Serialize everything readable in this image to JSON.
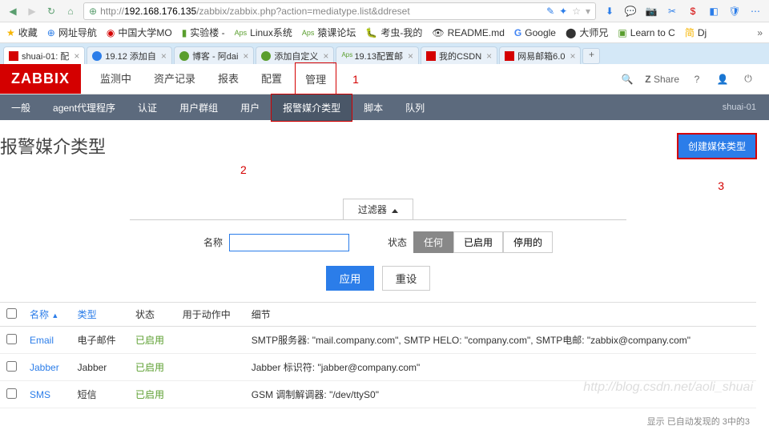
{
  "browser": {
    "url_prefix": "http://",
    "url_host": "192.168.176.135",
    "url_path": "/zabbix/zabbix.php?action=mediatype.list&ddreset"
  },
  "bookmarks": [
    "收藏",
    "网址导航",
    "中国大学MO",
    "实验楼 -",
    "Linux系统",
    "猿课论坛",
    "考虫-我的",
    "README.md",
    "Google",
    "大师兄",
    "Learn to C",
    "Dj"
  ],
  "tabs": [
    {
      "label": "shuai-01: 配",
      "active": true
    },
    {
      "label": "19.12 添加自",
      "active": false
    },
    {
      "label": "博客 - 阿dai",
      "active": false
    },
    {
      "label": "添加自定义",
      "active": false
    },
    {
      "label": "19.13配置邮",
      "active": false
    },
    {
      "label": "我的CSDN",
      "active": false
    },
    {
      "label": "网易邮箱6.0",
      "active": false
    }
  ],
  "zabbix_logo": "ZABBIX",
  "main_nav": [
    "监测中",
    "资产记录",
    "报表",
    "配置",
    "管理"
  ],
  "main_nav_active": 4,
  "annotations": {
    "a1": "1",
    "a2": "2",
    "a3": "3"
  },
  "header_share": "Share",
  "sub_nav": [
    "一般",
    "agent代理程序",
    "认证",
    "用户群组",
    "用户",
    "报警媒介类型",
    "脚本",
    "队列"
  ],
  "sub_nav_active": 5,
  "sub_nav_user": "shuai-01",
  "page_title": "报警媒介类型",
  "create_button": "创建媒体类型",
  "filter": {
    "tab": "过滤器",
    "name_label": "名称",
    "status_label": "状态",
    "status_options": [
      "任何",
      "已启用",
      "停用的"
    ],
    "status_active": 0,
    "apply": "应用",
    "reset": "重设"
  },
  "table": {
    "headers": {
      "name": "名称",
      "type": "类型",
      "status": "状态",
      "used_in": "用于动作中",
      "details": "细节"
    },
    "rows": [
      {
        "name": "Email",
        "type": "电子邮件",
        "status": "已启用",
        "details": "SMTP服务器: \"mail.company.com\", SMTP HELO: \"company.com\", SMTP电邮: \"zabbix@company.com\""
      },
      {
        "name": "Jabber",
        "type": "Jabber",
        "status": "已启用",
        "details": "Jabber 标识符: \"jabber@company.com\""
      },
      {
        "name": "SMS",
        "type": "短信",
        "status": "已启用",
        "details": "GSM 调制解调器: \"/dev/ttyS0\""
      }
    ],
    "footer": "显示 已自动发现的 3中的3"
  },
  "watermark": "http://blog.csdn.net/aoli_shuai"
}
